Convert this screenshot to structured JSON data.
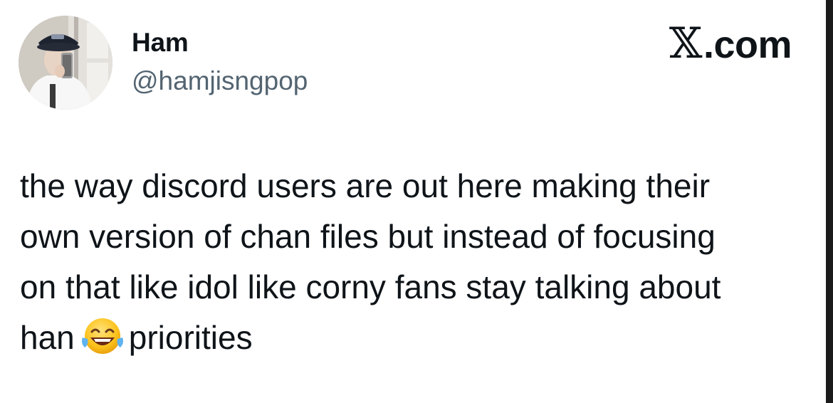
{
  "tweet": {
    "author": {
      "name": "Ham",
      "handle": "@hamjisngpop",
      "avatar_icon": "profile-photo"
    },
    "brand": {
      "label": ".com",
      "icon": "x-logo-icon"
    },
    "text_before_emoji": "the way discord users are out here making their\nown version of chan files but instead of focusing\non that like idol like corny fans stay talking about\nhan",
    "emoji": "face-with-tears-of-joy",
    "text_after_emoji": "priorities"
  }
}
